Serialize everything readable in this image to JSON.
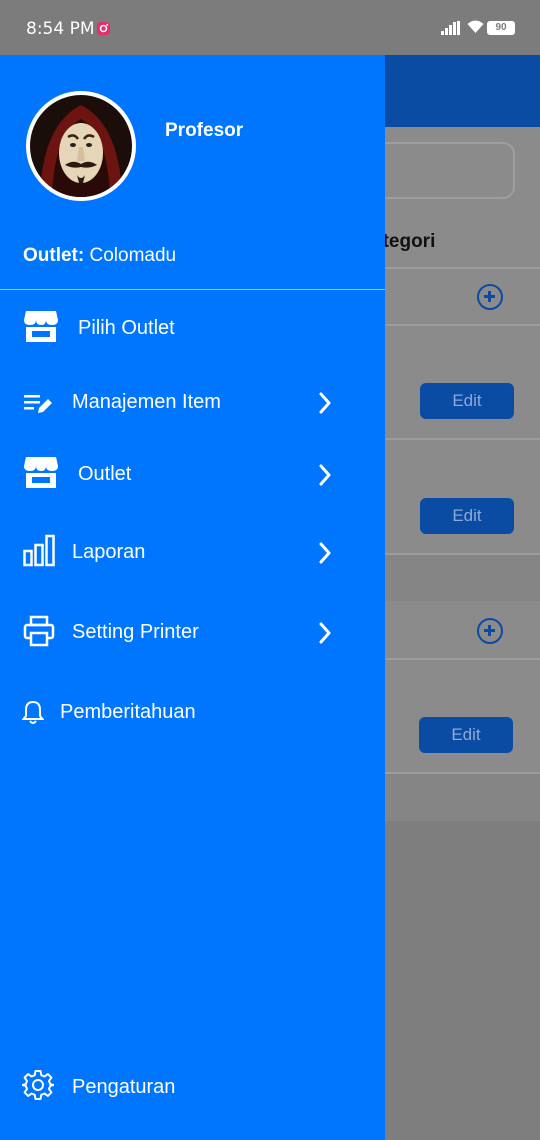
{
  "status_bar": {
    "time": "8:54 PM",
    "battery": "90",
    "notification_icon": "instagram-icon"
  },
  "background": {
    "heading_partial": "ategori",
    "edit_buttons": [
      "Edit",
      "Edit",
      "Edit"
    ]
  },
  "drawer": {
    "user_name": "Profesor",
    "outlet_label": "Outlet:",
    "outlet_value": "Colomadu",
    "menu": [
      {
        "label": "Pilih Outlet",
        "icon": "store-icon",
        "has_submenu": false
      },
      {
        "label": "Manajemen Item",
        "icon": "edit-list-icon",
        "has_submenu": true
      },
      {
        "label": "Outlet",
        "icon": "store-icon",
        "has_submenu": true
      },
      {
        "label": "Laporan",
        "icon": "bar-chart-icon",
        "has_submenu": true
      },
      {
        "label": "Setting Printer",
        "icon": "printer-icon",
        "has_submenu": true
      },
      {
        "label": "Pemberitahuan",
        "icon": "bell-icon",
        "has_submenu": false
      }
    ],
    "settings_label": "Pengaturan",
    "colors": {
      "drawer_bg": "#0076ff",
      "header_bg": "#0a4ca3"
    }
  }
}
